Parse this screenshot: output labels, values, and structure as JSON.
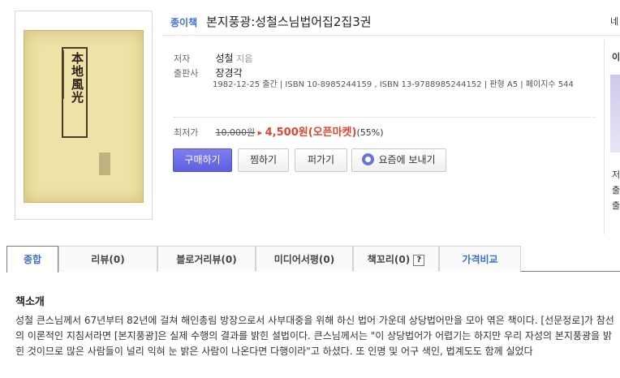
{
  "header": {
    "badge": "종이책",
    "title": "본지풍광:성철스님법어집2집3권",
    "right_cut": "네"
  },
  "cover": {
    "title_text": "本地風光"
  },
  "info": {
    "author_label": "저자",
    "author_name": "성철",
    "author_role": "지음",
    "publisher_label": "출판사",
    "publisher_name": "장경각",
    "pub_details": "1982-12-25 출간  |  ISBN 10-8985244159 , ISBN 13-9788985244152  |  판형 A5  |  페이지수 544",
    "price_label": "최저가",
    "list_price": "10,000원",
    "sale_price": "4,500원(오픈마켓)",
    "discount": "(55%)"
  },
  "actions": {
    "buy": "구매하기",
    "wish": "찜하기",
    "share": "퍼가기",
    "send": "요즘에 보내기"
  },
  "side": {
    "top": "이",
    "lines": [
      "저",
      "출",
      "출"
    ]
  },
  "tabs": [
    {
      "label": "종합"
    },
    {
      "label": "리뷰(0)"
    },
    {
      "label": "블로거리뷰(0)"
    },
    {
      "label": "미디어서평(0)"
    },
    {
      "label": "책꼬리(0)"
    },
    {
      "label": "가격비교"
    }
  ],
  "tab_help": "?",
  "intro": {
    "title": "책소개",
    "body": "성철 큰스님께서 67년부터 82년에 걸쳐 해인총림 방장으로서 사부대중을 위해 하신 법어 가운데 상당법어만을 모아 엮은 책이다. [선문정로]가 참선의 이론적인 지침서라면 [본지풍광]은 실제 수행의 결과를 밝힌 설법이다. 큰스님께서는 \"이 상당법어가 어렵기는 하지만 우리 자성의 본지풍광을 밝힌 것이므로 많은 사람들이 널리 익혀 눈 밝은 사람이 나온다면 다행이라\"고 하셨다. 또 인명 및 어구 색인, 법계도도 함께 실었다"
  },
  "colors": {
    "accent": "#3f6fd8",
    "sale": "#e04530",
    "buy_button": "#5d5ee0"
  }
}
